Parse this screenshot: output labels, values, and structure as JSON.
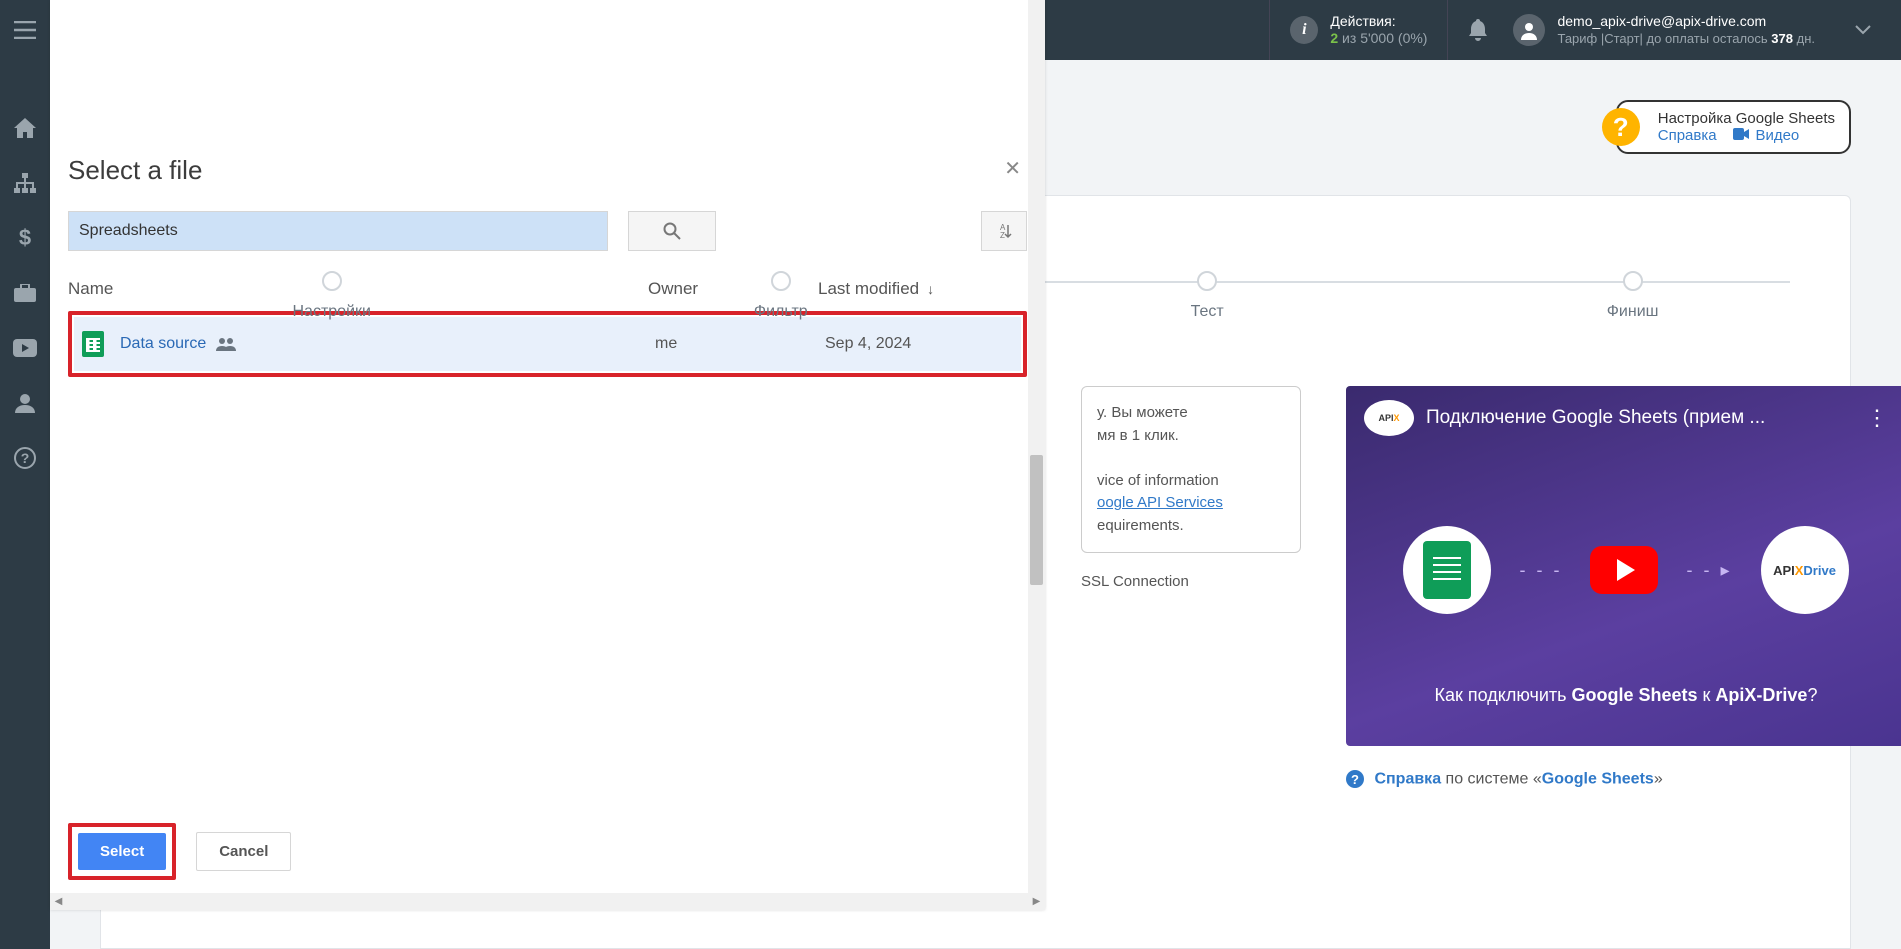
{
  "sidebar": {
    "items": [
      "home",
      "sitemap",
      "dollar",
      "briefcase",
      "youtube",
      "user",
      "question"
    ]
  },
  "topbar": {
    "actions_label": "Действия:",
    "actions_count": "2",
    "actions_of": "из",
    "actions_total": "5'000",
    "actions_pct": "(0%)",
    "email": "demo_apix-drive@apix-drive.com",
    "tariff_line_prefix": "Тариф |Старт|  до оплаты осталось ",
    "tariff_days": "378",
    "tariff_suffix": " дн."
  },
  "help_box": {
    "title": "Настройка Google Sheets",
    "link1": "Справка",
    "link2": "Видео"
  },
  "steps": {
    "s1": "Настройки",
    "s2": "Фильтр",
    "s3": "Тест",
    "s4": "Финиш"
  },
  "info_panel": {
    "line1_frag": "у. Вы можете",
    "line2_frag": "мя в 1 клик.",
    "svc_frag1": "vice of information",
    "svc_link": "oogle API Services",
    "svc_frag2": "equirements.",
    "ssl": "SSL Connection"
  },
  "video": {
    "title": "Подключение Google Sheets (прием ...",
    "caption_pre": "Как подключить ",
    "caption_bold1": "Google Sheets",
    "caption_mid": " к ",
    "caption_bold2": "ApiX-Drive",
    "caption_q": "?"
  },
  "ref_line": {
    "t1": "Справка",
    "t2": " по системе «",
    "t3": "Google Sheets",
    "t4": "»"
  },
  "picker": {
    "title": "Select a file",
    "input_value": "Spreadsheets",
    "col_name": "Name",
    "col_owner": "Owner",
    "col_modified": "Last modified",
    "file_name": "Data source",
    "file_owner": "me",
    "file_date": "Sep 4, 2024",
    "btn_select": "Select",
    "btn_cancel": "Cancel"
  }
}
